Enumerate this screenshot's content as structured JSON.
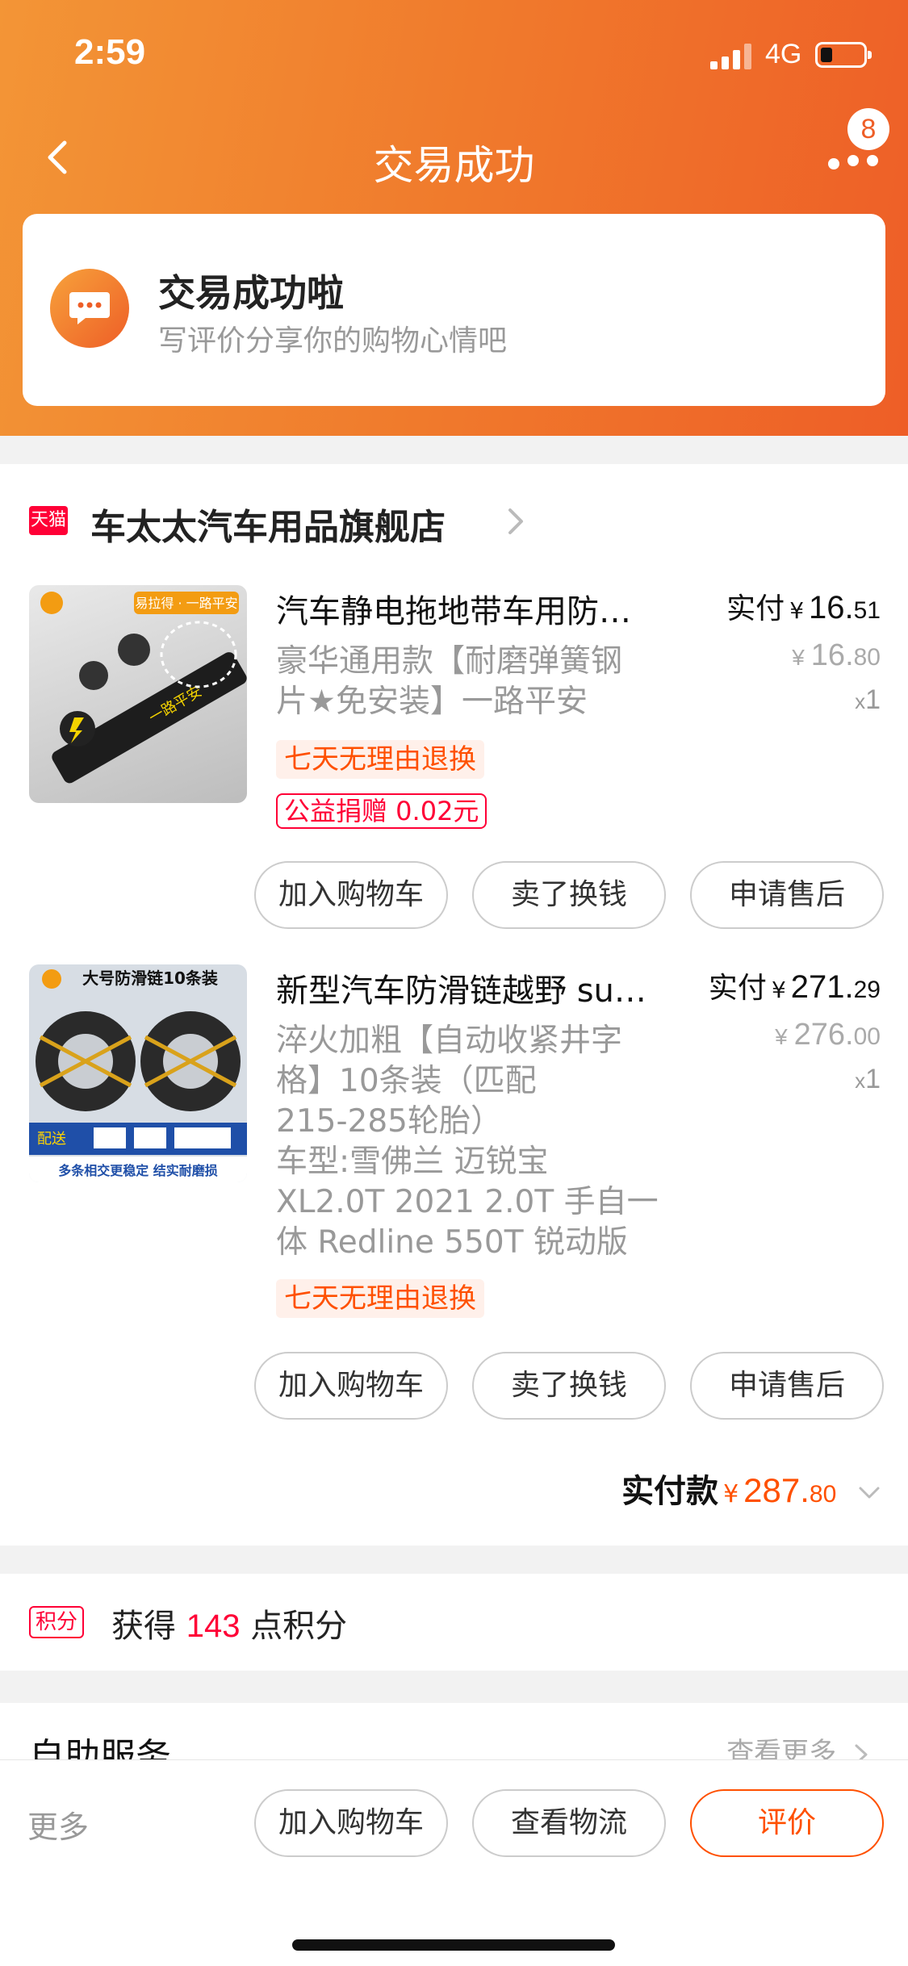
{
  "status_bar": {
    "time": "2:59",
    "network": "4G"
  },
  "nav": {
    "title": "交易成功",
    "badge_count": "8"
  },
  "success": {
    "title": "交易成功啦",
    "subtitle": "写评价分享你的购物心情吧"
  },
  "shop": {
    "platform_tag": "天猫",
    "name": "车太太汽车用品旗舰店"
  },
  "items": [
    {
      "title": "汽车静电拖地带车用防…",
      "spec_lines": [
        "豪华通用款【耐磨弹簧钢",
        "片★免安装】一路平安"
      ],
      "tags": [
        "七天无理由退换",
        "公益捐赠 0.02元"
      ],
      "pay_label": "实付",
      "pay_yen": "¥",
      "pay_int": "16.",
      "pay_dec": "51",
      "orig_yen": "¥",
      "orig_int": "16.",
      "orig_dec": "80",
      "qty_x": "x",
      "qty": "1",
      "thumb_text": {
        "banner": "易拉得 · 一路平安",
        "strap": "一路平安"
      },
      "buttons": [
        "加入购物车",
        "卖了换钱",
        "申请售后"
      ]
    },
    {
      "title": "新型汽车防滑链越野 su…",
      "spec_lines": [
        "淬火加粗【自动收紧井字",
        "格】10条装（匹配",
        "215-285轮胎）",
        "车型:雪佛兰 迈锐宝",
        "XL2.0T 2021 2.0T 手自一",
        "体 Redline 550T 锐动版"
      ],
      "tags": [
        "七天无理由退换"
      ],
      "pay_label": "实付",
      "pay_yen": "¥",
      "pay_int": "271.",
      "pay_dec": "29",
      "orig_yen": "¥",
      "orig_int": "276.",
      "orig_dec": "00",
      "qty_x": "x",
      "qty": "1",
      "thumb_text": {
        "banner": "大号防滑链10条装",
        "promo": "配送",
        "footer": "多条相交更稳定 结实耐磨损"
      },
      "buttons": [
        "加入购物车",
        "卖了换钱",
        "申请售后"
      ]
    }
  ],
  "total": {
    "label": "实付款",
    "yen": "¥",
    "int": "287.",
    "dec": "80"
  },
  "points": {
    "badge": "积分",
    "prefix": "获得",
    "value": "143",
    "suffix": "点积分"
  },
  "service": {
    "title": "自助服务",
    "more": "查看更多"
  },
  "bottom_bar": {
    "more": "更多",
    "buttons": [
      "加入购物车",
      "查看物流",
      "评价"
    ]
  },
  "colors": {
    "accent": "#ff5000",
    "header_start": "#f39536",
    "header_end": "#ee5e27",
    "tmall_red": "#ff0036"
  }
}
